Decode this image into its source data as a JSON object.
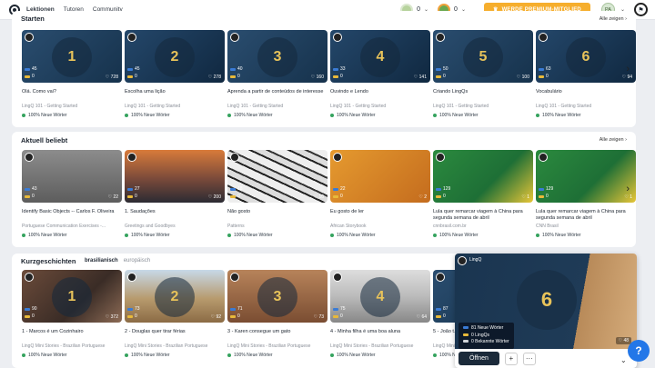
{
  "nav": {
    "lessons": "Lektionen",
    "tutors": "Tutoren",
    "community": "Community"
  },
  "header": {
    "streak_a": "0",
    "streak_b": "0",
    "premium": "WERDE PREMIUM-MITGLIED",
    "avatar": "PA"
  },
  "starten": {
    "title": "Starten",
    "link": "Alle zeigen",
    "cards": [
      {
        "num": "1",
        "title": "Olá. Como vai?",
        "sub": "LingQ 101 - Getting Started",
        "words": "100% Neue Wörter",
        "stat1": "45",
        "stat2": "0",
        "likes": "728"
      },
      {
        "num": "2",
        "title": "Escolha uma lição",
        "sub": "LingQ 101 - Getting Started",
        "words": "100% Neue Wörter",
        "stat1": "45",
        "stat2": "0",
        "likes": "278"
      },
      {
        "num": "3",
        "title": "Aprenda a partir de conteúdos de interesse",
        "sub": "LingQ 101 - Getting Started",
        "words": "100% Neue Wörter",
        "stat1": "40",
        "stat2": "0",
        "likes": "160"
      },
      {
        "num": "4",
        "title": "Ouvindo e Lendo",
        "sub": "LingQ 101 - Getting Started",
        "words": "100% Neue Wörter",
        "stat1": "33",
        "stat2": "0",
        "likes": "141"
      },
      {
        "num": "5",
        "title": "Criando LingQs",
        "sub": "LingQ 101 - Getting Started",
        "words": "100% Neue Wörter",
        "stat1": "50",
        "stat2": "0",
        "likes": "100"
      },
      {
        "num": "6",
        "title": "Vocabulário",
        "sub": "LingQ 101 - Getting Started",
        "words": "100% Neue Wörter",
        "stat1": "63",
        "stat2": "0",
        "likes": "94"
      }
    ]
  },
  "beliebt": {
    "title": "Aktuell beliebt",
    "link": "Alle zeigen",
    "cards": [
      {
        "title": "Identify Basic Objects -- Carlos F. Oliveira",
        "sub": "Portuguese Communication Exercises -...",
        "words": "100% Neue Wörter",
        "stat1": "43",
        "stat2": "0",
        "likes": "22"
      },
      {
        "title": "1. Saudações",
        "sub": "Greetings and Goodbyes",
        "words": "100% Neue Wörter",
        "stat1": "27",
        "stat2": "0",
        "likes": "200"
      },
      {
        "title": "Não gosto",
        "sub": "Patterns",
        "words": "100% Neue Wörter",
        "stat1": "18",
        "stat2": "0",
        "likes": "10"
      },
      {
        "title": "Eu gosto de ler",
        "sub": "African Storybook",
        "words": "100% Neue Wörter",
        "stat1": "22",
        "stat2": "0",
        "likes": "2"
      },
      {
        "title": "Lula quer remarcar viagem à China para segunda semana de abril",
        "sub": "cnnbrasil.com.br",
        "words": "100% Neue Wörter",
        "stat1": "129",
        "stat2": "0",
        "likes": "1"
      },
      {
        "title": "Lula quer remarcar viagem à China para segunda semana de abril",
        "sub": "CNN Brasil",
        "words": "100% Neue Wörter",
        "stat1": "129",
        "stat2": "0",
        "likes": "1"
      }
    ]
  },
  "kurz": {
    "title": "Kurzgeschichten",
    "tab_on": "brasilianisch",
    "tab_off": "europäisch",
    "cards": [
      {
        "num": "1",
        "title": "1 - Marcos é um Cozinhairo",
        "sub": "LingQ Mini Stories - Brazilian Portuguese",
        "words": "100% Neue Wörter",
        "stat1": "90",
        "stat2": "0",
        "likes": "372"
      },
      {
        "num": "2",
        "title": "2 - Douglas quer tirar férias",
        "sub": "LingQ Mini Stories - Brazilian Portuguese",
        "words": "100% Neue Wörter",
        "stat1": "73",
        "stat2": "0",
        "likes": "92"
      },
      {
        "num": "3",
        "title": "3 - Karen consegue um gato",
        "sub": "LingQ Mini Stories - Brazilian Portuguese",
        "words": "100% Neue Wörter",
        "stat1": "71",
        "stat2": "0",
        "likes": "73"
      },
      {
        "num": "4",
        "title": "4 - Minha filha é uma boa aluna",
        "sub": "LingQ Mini Stories - Brazilian Portuguese",
        "words": "100% Neue Wörter",
        "stat1": "75",
        "stat2": "0",
        "likes": "64"
      },
      {
        "num": "5",
        "title": "5 - João t...",
        "sub": "LingQ Mini S...",
        "words": "100% Neue Wörter",
        "stat1": "87",
        "stat2": "0",
        "likes": ""
      }
    ]
  },
  "popup": {
    "brand": "LingQ",
    "num": "6",
    "new_words": "81 Neue Wörter",
    "lingqs": "0 LingQs",
    "known": "0 Bekannte Wörter",
    "likes": "48",
    "open": "Öffnen",
    "plus": "+",
    "more": "···"
  },
  "help": "?"
}
